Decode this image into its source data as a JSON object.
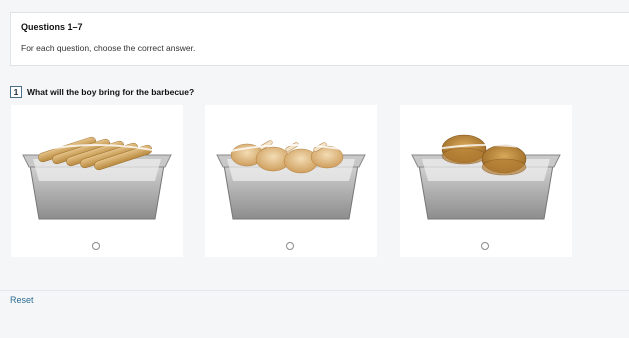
{
  "instructions": {
    "title": "Questions 1–7",
    "text": "For each question, choose the correct answer."
  },
  "question": {
    "number": "1",
    "text": "What will the boy bring for the barbecue?"
  },
  "options": [
    {
      "image": "sausages-tray",
      "selected": false
    },
    {
      "image": "chicken-legs-tray",
      "selected": false
    },
    {
      "image": "burgers-tray",
      "selected": false
    }
  ],
  "footer": {
    "reset_label": "Reset"
  },
  "colors": {
    "accent": "#2d6e92",
    "question_box_border": "#4a6f8a",
    "background": "#f4f6f7"
  }
}
